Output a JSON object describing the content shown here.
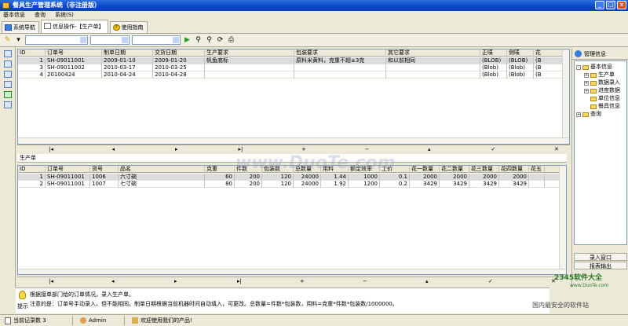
{
  "window": {
    "title": "餐具生产管理系统（非注册版）"
  },
  "menu": [
    "基本信息",
    "查询",
    "系统(S)"
  ],
  "tabs": [
    {
      "label": "系统导航"
    },
    {
      "label": "信息操作-【生产单】"
    },
    {
      "label": "使用指南"
    }
  ],
  "orders": {
    "columns": [
      "ID",
      "订单号",
      "制单日期",
      "交货日期",
      "生产要求",
      "包装要求",
      "其它要求",
      "正唛",
      "侧唛",
      "花"
    ],
    "rows": [
      [
        "1",
        "SH-09011001",
        "2009-01-10",
        "2009-01-20",
        "帆鱼底标",
        "原料米黄料，克重不超±3克",
        "和以前相同",
        "(BLOB)",
        "(BLOB)",
        "(B"
      ],
      [
        "3",
        "SH-09011002",
        "2010-03-17",
        "2010-03-25",
        "",
        "",
        "",
        "(Blob)",
        "(Blob)",
        "(B"
      ],
      [
        "4",
        "20100424",
        "2010-04-24",
        "2010-04-28",
        "",
        "",
        "",
        "(Blob)",
        "(Blob)",
        "(B"
      ]
    ]
  },
  "nav_top": [
    "|◂",
    "◂",
    "▸",
    "▸|",
    "+",
    "−",
    "▴",
    "✓",
    "✕"
  ],
  "section": {
    "label": "生产单"
  },
  "production": {
    "columns": [
      "ID",
      "订单号",
      "货号",
      "品名",
      "克重",
      "件数",
      "包装数",
      "总数量",
      "用料",
      "额定效率",
      "工价",
      "花一数量",
      "花二数量",
      "花三数量",
      "花四数量",
      "花五"
    ],
    "rows": [
      [
        "1",
        "SH-09011001",
        "1006",
        "六寸碗",
        "60",
        "200",
        "120",
        "24000",
        "1.44",
        "1000",
        "0.1",
        "2000",
        "2000",
        "2000",
        "2000",
        ""
      ],
      [
        "2",
        "SH-09011001",
        "1007",
        "七寸碗",
        "80",
        "200",
        "120",
        "24000",
        "1.92",
        "1200",
        "0.2",
        "3429",
        "3429",
        "3429",
        "3429",
        ""
      ]
    ]
  },
  "nav_bottom": [
    "|◂",
    "◂",
    "▸",
    "▸|",
    "+",
    "−",
    "▴",
    "✓",
    "✕"
  ],
  "right_panel": {
    "title": "管理信息",
    "tree": [
      {
        "label": "基本信息",
        "level": 0,
        "exp": "-"
      },
      {
        "label": "生产单",
        "level": 1,
        "exp": "+"
      },
      {
        "label": "数据录入",
        "level": 1,
        "exp": "+"
      },
      {
        "label": "进度数据",
        "level": 1,
        "exp": "+"
      },
      {
        "label": "单位信息",
        "level": 1,
        "exp": ""
      },
      {
        "label": "餐具信息",
        "level": 1,
        "exp": ""
      },
      {
        "label": "查询",
        "level": 0,
        "exp": "+"
      }
    ],
    "buttons": [
      "录入窗口",
      "报表输出"
    ]
  },
  "hint": {
    "line1": "根据接单部门给的订单情况，录入生产单。",
    "line2": "注意的是：订单号手动录入，但不能相同。制单日期根据当前机器时间自动填入，可更改。总数量=件数*包装数，用料=克重*件数*包装数/1000000。",
    "label": "提示"
  },
  "status": {
    "records": "当前记录数 3",
    "user": "Admin",
    "welcome": "欢迎使用我们的产品!"
  },
  "watermark": "www.DuoTe.com",
  "logo": {
    "site": "2345软件大全",
    "url": "www.DuoTe.com",
    "slogan": "国内最安全的软件站"
  }
}
